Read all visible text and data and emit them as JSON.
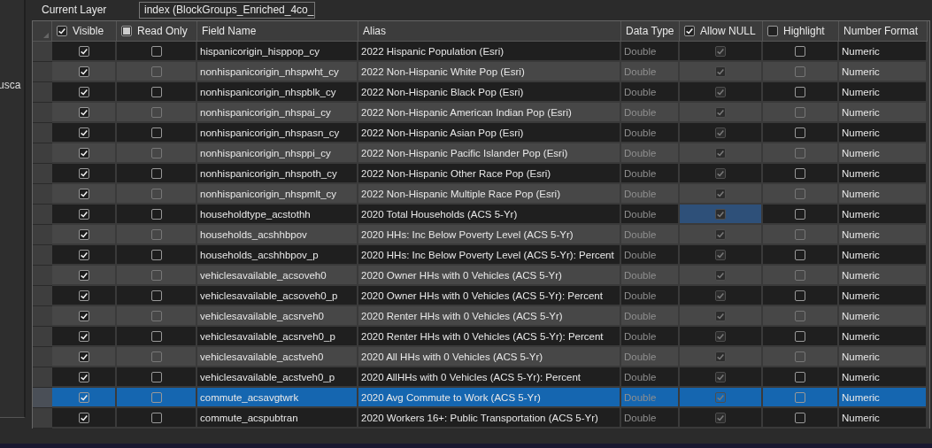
{
  "side_panel": {
    "text": "usca"
  },
  "layer": {
    "label": "Current Layer",
    "value": "index (BlockGroups_Enriched_4co_"
  },
  "table": {
    "columns": [
      {
        "label": "Visible",
        "kind": "check",
        "checked": true,
        "mixed": false
      },
      {
        "label": "Read Only",
        "kind": "check",
        "checked": false,
        "mixed": true
      },
      {
        "label": "Field Name",
        "kind": "text"
      },
      {
        "label": "Alias",
        "kind": "text"
      },
      {
        "label": "Data Type",
        "kind": "muted"
      },
      {
        "label": "Allow NULL",
        "kind": "disabled_check",
        "checked": true,
        "mixed": false
      },
      {
        "label": "Highlight",
        "kind": "check",
        "checked": false,
        "mixed": false
      },
      {
        "label": "Number Format",
        "kind": "text"
      }
    ],
    "rows": [
      {
        "cells": [
          true,
          false,
          "hispanicorigin_hisppop_cy",
          "2022 Hispanic Population (Esri)",
          "Double",
          true,
          false,
          "Numeric"
        ],
        "selected": false,
        "focused": false
      },
      {
        "cells": [
          true,
          false,
          "nonhispanicorigin_nhspwht_cy",
          "2022 Non-Hispanic White Pop (Esri)",
          "Double",
          true,
          false,
          "Numeric"
        ],
        "selected": false,
        "focused": false
      },
      {
        "cells": [
          true,
          false,
          "nonhispanicorigin_nhspblk_cy",
          "2022 Non-Hispanic Black Pop (Esri)",
          "Double",
          true,
          false,
          "Numeric"
        ],
        "selected": false,
        "focused": false
      },
      {
        "cells": [
          true,
          false,
          "nonhispanicorigin_nhspai_cy",
          "2022 Non-Hispanic American Indian Pop (Esri)",
          "Double",
          true,
          false,
          "Numeric"
        ],
        "selected": false,
        "focused": false
      },
      {
        "cells": [
          true,
          false,
          "nonhispanicorigin_nhspasn_cy",
          "2022 Non-Hispanic Asian Pop (Esri)",
          "Double",
          true,
          false,
          "Numeric"
        ],
        "selected": false,
        "focused": false
      },
      {
        "cells": [
          true,
          false,
          "nonhispanicorigin_nhsppi_cy",
          "2022 Non-Hispanic Pacific Islander Pop (Esri)",
          "Double",
          true,
          false,
          "Numeric"
        ],
        "selected": false,
        "focused": false
      },
      {
        "cells": [
          true,
          false,
          "nonhispanicorigin_nhspoth_cy",
          "2022 Non-Hispanic Other Race Pop (Esri)",
          "Double",
          true,
          false,
          "Numeric"
        ],
        "selected": false,
        "focused": false
      },
      {
        "cells": [
          true,
          false,
          "nonhispanicorigin_nhspmlt_cy",
          "2022 Non-Hispanic Multiple Race Pop (Esri)",
          "Double",
          true,
          false,
          "Numeric"
        ],
        "selected": false,
        "focused": false
      },
      {
        "cells": [
          true,
          false,
          "householdtype_acstothh",
          "2020 Total Households (ACS 5-Yr)",
          "Double",
          true,
          false,
          "Numeric"
        ],
        "selected": false,
        "focused": true
      },
      {
        "cells": [
          true,
          false,
          "households_acshhbpov",
          "2020 HHs: Inc Below Poverty Level (ACS 5-Yr)",
          "Double",
          true,
          false,
          "Numeric"
        ],
        "selected": false,
        "focused": false
      },
      {
        "cells": [
          true,
          false,
          "households_acshhbpov_p",
          "2020 HHs: Inc Below Poverty Level (ACS 5-Yr): Percent",
          "Double",
          true,
          false,
          "Numeric"
        ],
        "selected": false,
        "focused": false
      },
      {
        "cells": [
          true,
          false,
          "vehiclesavailable_acsoveh0",
          "2020 Owner HHs with 0 Vehicles (ACS 5-Yr)",
          "Double",
          true,
          false,
          "Numeric"
        ],
        "selected": false,
        "focused": false
      },
      {
        "cells": [
          true,
          false,
          "vehiclesavailable_acsoveh0_p",
          "2020 Owner HHs with 0 Vehicles (ACS 5-Yr): Percent",
          "Double",
          true,
          false,
          "Numeric"
        ],
        "selected": false,
        "focused": false
      },
      {
        "cells": [
          true,
          false,
          "vehiclesavailable_acsrveh0",
          "2020 Renter HHs with 0 Vehicles (ACS 5-Yr)",
          "Double",
          true,
          false,
          "Numeric"
        ],
        "selected": false,
        "focused": false
      },
      {
        "cells": [
          true,
          false,
          "vehiclesavailable_acsrveh0_p",
          "2020 Renter HHs with 0 Vehicles (ACS 5-Yr): Percent",
          "Double",
          true,
          false,
          "Numeric"
        ],
        "selected": false,
        "focused": false
      },
      {
        "cells": [
          true,
          false,
          "vehiclesavailable_acstveh0",
          "2020 All HHs with 0 Vehicles (ACS 5-Yr)",
          "Double",
          true,
          false,
          "Numeric"
        ],
        "selected": false,
        "focused": false
      },
      {
        "cells": [
          true,
          false,
          "vehiclesavailable_acstveh0_p",
          "2020 AllHHs with 0 Vehicles (ACS 5-Yr): Percent",
          "Double",
          true,
          false,
          "Numeric"
        ],
        "selected": false,
        "focused": false
      },
      {
        "cells": [
          true,
          false,
          "commute_acsavgtwrk",
          "2020 Avg Commute to Work (ACS 5-Yr)",
          "Double",
          true,
          false,
          "Numeric"
        ],
        "selected": true,
        "focused": false
      },
      {
        "cells": [
          true,
          false,
          "commute_acspubtran",
          "2020 Workers 16+: Public Transportation (ACS 5-Yr)",
          "Double",
          true,
          false,
          "Numeric"
        ],
        "selected": false,
        "focused": false
      }
    ]
  }
}
